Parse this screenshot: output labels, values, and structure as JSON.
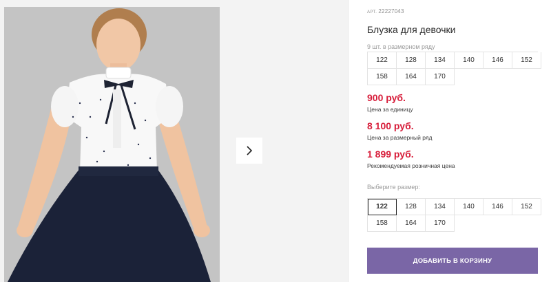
{
  "product": {
    "article_label": "АРТ.",
    "article": "22227043",
    "title": "Блузка для девочки",
    "size_row_caption": "9 шт. в размерном ряду",
    "size_row": [
      "122",
      "128",
      "134",
      "140",
      "146",
      "152",
      "158",
      "164",
      "170"
    ]
  },
  "prices": {
    "unit_price": "900 руб.",
    "unit_caption": "Цена за единицу",
    "row_price": "8 100 руб.",
    "row_caption": "Цена за размерный ряд",
    "retail_price": "1 899 руб.",
    "retail_caption": "Рекомендуемая розничная цена"
  },
  "size_select": {
    "label": "Выберите размер:",
    "options": [
      "122",
      "128",
      "134",
      "140",
      "146",
      "152",
      "158",
      "164",
      "170"
    ],
    "selected": "122"
  },
  "cart": {
    "add_label": "ДОБАВИТЬ В КОРЗИНУ"
  },
  "colors": {
    "price": "#d71d3a",
    "button": "#7a66a6"
  },
  "gallery": {
    "next_icon": "chevron-right-icon"
  }
}
